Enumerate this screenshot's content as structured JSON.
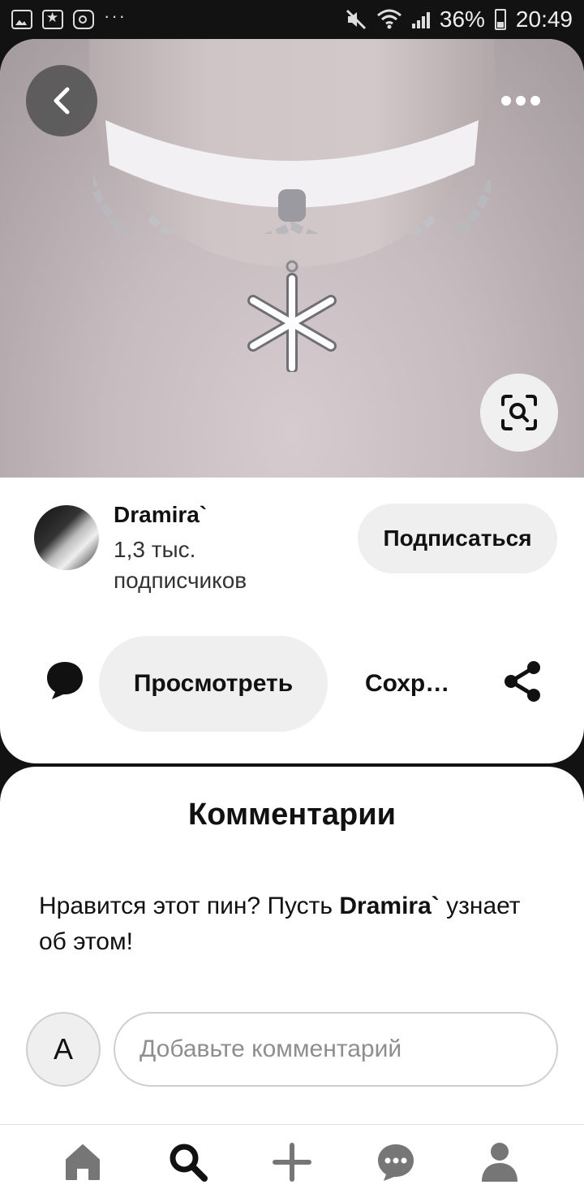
{
  "status_bar": {
    "battery": "36%",
    "time": "20:49",
    "dots": "···"
  },
  "pin": {
    "author_name": "Dramira`",
    "followers_line1": "1,3 тыс.",
    "followers_line2": "подписчиков",
    "subscribe_label": "Подписаться",
    "view_label": "Просмотреть",
    "save_label": "Сохр…"
  },
  "comments": {
    "title": "Комментарии",
    "prompt_before": "Нравится этот пин? Пусть ",
    "prompt_author": "Dramira`",
    "prompt_after": " узнает об этом!",
    "user_initial": "A",
    "input_placeholder": "Добавьте комментарий"
  },
  "icons": [
    "gallery-icon",
    "star-icon",
    "instagram-icon",
    "mute-icon",
    "wifi-icon",
    "signal-icon",
    "battery-icon",
    "back-icon",
    "more-icon",
    "visual-search-icon",
    "comment-icon",
    "share-icon",
    "home-icon",
    "search-icon",
    "plus-icon",
    "messages-icon",
    "profile-icon"
  ],
  "colors": {
    "background": "#121212",
    "card": "#ffffff",
    "button_bg": "#efefef",
    "nav_icon": "#767676",
    "nav_active": "#111111"
  }
}
